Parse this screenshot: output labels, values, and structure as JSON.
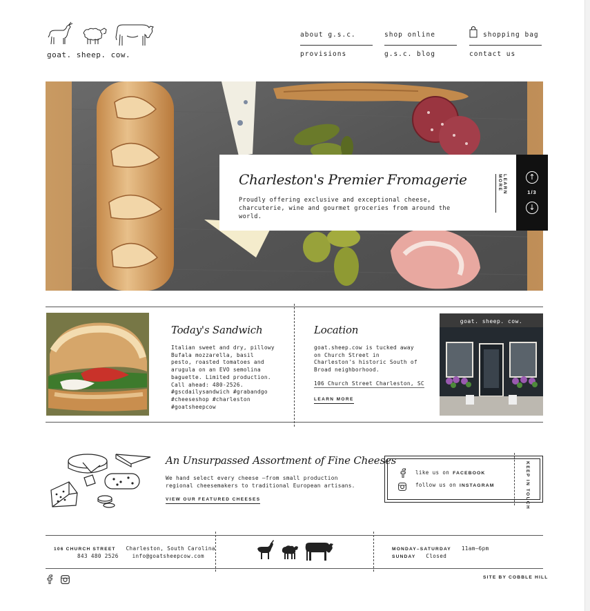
{
  "brand": {
    "logo_text": "goat.  sheep.  cow."
  },
  "nav": {
    "about": "about g.s.c.",
    "shop_online": "shop online",
    "shopping_bag": "shopping bag",
    "provisions": "provisions",
    "blog": "g.s.c. blog",
    "contact": "contact us"
  },
  "hero": {
    "title": "Charleston's Premier Fromagerie",
    "description": "Proudly offering exclusive and exceptional cheese, charcuterie, wine and gourmet groceries from around the world.",
    "learn_more": "LEARN MORE",
    "counter": "1/3"
  },
  "sandwich": {
    "title": "Today's Sandwich",
    "body": "Italian sweet and dry, pillowy Bufala mozzarella, basil pesto, roasted tomatoes and arugula on an EVO semolina baguette. Limited production. Call ahead: 480-2526. #gscdailysandwich #grabandgo #cheeseshop #charleston #goatsheepcow"
  },
  "location": {
    "title": "Location",
    "body": "goat.sheep.cow is tucked away on Church Street in Charleston's historic South of Broad neighborhood.",
    "address_link": "106 Church Street Charleston, SC",
    "learn_more": "LEARN MORE",
    "storefront_sign": "goat. sheep. cow."
  },
  "cheeses": {
    "title": "An Unsurpassed Assortment of Fine Cheeses",
    "body": "We hand select every cheese —from small production regional cheesemakers to traditional European artisans.",
    "link": "VIEW OUR FEATURED CHEESES"
  },
  "social": {
    "facebook_prefix": "like us on",
    "facebook": "FACEBOOK",
    "instagram_prefix": "follow us on",
    "instagram": "INSTAGRAM",
    "keep_in_touch": "KEEP IN TOUCH"
  },
  "footer": {
    "street": "106 CHURCH STREET",
    "city": "Charleston, South Carolina",
    "phone": "843 480 2526",
    "email": "info@goatsheepcow.com",
    "hours_days": "MONDAY–SATURDAY",
    "hours_time": "11am–6pm",
    "sunday": "SUNDAY",
    "sunday_status": "Closed",
    "credit": "SITE BY COBBLE HILL"
  },
  "icons": {
    "facebook": "facebook-icon",
    "instagram": "instagram-icon",
    "bag": "shopping-bag-icon",
    "up": "arrow-up-circle-icon",
    "down": "arrow-down-circle-icon"
  }
}
